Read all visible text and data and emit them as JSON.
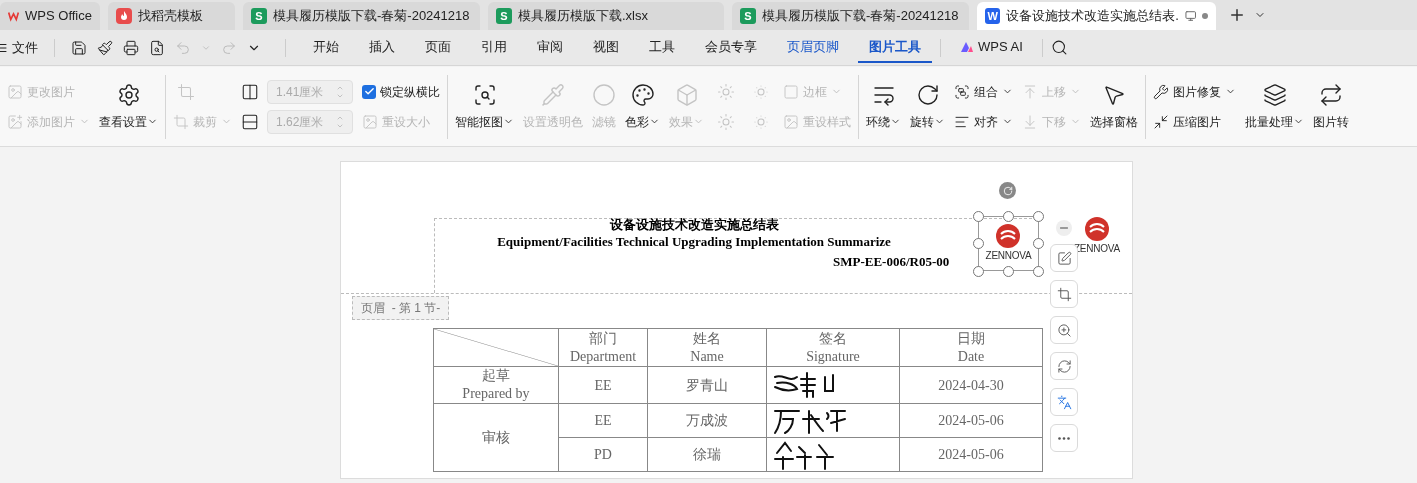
{
  "tabs": [
    {
      "label": "WPS Office",
      "kind": "wps",
      "selected": false
    },
    {
      "label": "找稻壳模板",
      "kind": "template",
      "selected": false
    },
    {
      "label": "模具履历模版下载-春菊-20241218",
      "kind": "sheet",
      "badge": "S",
      "selected": false
    },
    {
      "label": "模具履历模版下载.xlsx",
      "kind": "sheet",
      "badge": "S",
      "selected": false
    },
    {
      "label": "模具履历模版下载-春菊-20241218",
      "kind": "sheet",
      "badge": "S",
      "selected": false
    },
    {
      "label": "设备设施技术改造实施总结表.",
      "kind": "doc",
      "badge": "W",
      "selected": true
    }
  ],
  "menu": {
    "file": "文件",
    "items": [
      {
        "label": "开始",
        "kind": "plain",
        "selected": false
      },
      {
        "label": "插入",
        "kind": "plain",
        "selected": false
      },
      {
        "label": "页面",
        "kind": "plain",
        "selected": false
      },
      {
        "label": "引用",
        "kind": "plain",
        "selected": false
      },
      {
        "label": "审阅",
        "kind": "plain",
        "selected": false
      },
      {
        "label": "视图",
        "kind": "plain",
        "selected": false
      },
      {
        "label": "工具",
        "kind": "plain",
        "selected": false
      },
      {
        "label": "会员专享",
        "kind": "plain",
        "selected": false
      },
      {
        "label": "页眉页脚",
        "kind": "context",
        "selected": false
      },
      {
        "label": "图片工具",
        "kind": "context",
        "selected": true
      },
      {
        "label": "WPS AI",
        "kind": "ai",
        "selected": false
      }
    ]
  },
  "ribbon": {
    "groups": [
      {
        "columns": [
          {
            "kind": "stack",
            "items": [
              {
                "kind": "button",
                "label": "更改图片",
                "disabled": true,
                "dropdown": false
              },
              {
                "kind": "button",
                "label": "添加图片",
                "disabled": true,
                "dropdown": true
              }
            ]
          },
          {
            "kind": "large",
            "label": "查看设置",
            "disabled": false,
            "dropdown": true
          }
        ]
      },
      {
        "columns": [
          {
            "kind": "stack",
            "items": [
              {
                "kind": "icon",
                "disabled": true
              },
              {
                "kind": "button",
                "label": "裁剪",
                "disabled": true,
                "dropdown": true
              }
            ]
          },
          {
            "kind": "stack",
            "items": [
              {
                "kind": "size",
                "value": "1.41厘米",
                "disabled": true
              },
              {
                "kind": "size",
                "value": "1.62厘米",
                "disabled": true
              }
            ]
          },
          {
            "kind": "stack",
            "items": [
              {
                "kind": "check",
                "label": "锁定纵横比",
                "checked": true
              },
              {
                "kind": "button",
                "label": "重设大小",
                "disabled": true,
                "dropdown": false
              }
            ]
          }
        ]
      },
      {
        "columns": [
          {
            "kind": "large",
            "label": "智能抠图",
            "disabled": false,
            "dropdown": true
          },
          {
            "kind": "large",
            "label": "设置透明色",
            "disabled": true,
            "dropdown": false
          },
          {
            "kind": "large",
            "label": "滤镜",
            "disabled": true,
            "dropdown": false
          },
          {
            "kind": "large",
            "label": "色彩",
            "disabled": false,
            "dropdown": true
          },
          {
            "kind": "large",
            "label": "效果",
            "disabled": true,
            "dropdown": true
          },
          {
            "kind": "stack",
            "items": [
              {
                "kind": "icon",
                "disabled": true
              },
              {
                "kind": "icon",
                "disabled": true
              }
            ]
          },
          {
            "kind": "stack",
            "items": [
              {
                "kind": "icon",
                "disabled": true
              },
              {
                "kind": "icon",
                "disabled": true
              }
            ]
          },
          {
            "kind": "stack",
            "items": [
              {
                "kind": "button",
                "label": "边框",
                "disabled": true,
                "dropdown": true
              },
              {
                "kind": "button",
                "label": "重设样式",
                "disabled": true,
                "dropdown": false
              }
            ]
          }
        ]
      },
      {
        "columns": [
          {
            "kind": "large",
            "label": "环绕",
            "disabled": false,
            "dropdown": true
          },
          {
            "kind": "large",
            "label": "旋转",
            "disabled": false,
            "dropdown": true
          },
          {
            "kind": "stack",
            "items": [
              {
                "kind": "button",
                "label": "组合",
                "disabled": false,
                "dropdown": true
              },
              {
                "kind": "button",
                "label": "对齐",
                "disabled": false,
                "dropdown": true
              }
            ]
          },
          {
            "kind": "stack",
            "items": [
              {
                "kind": "button",
                "label": "上移",
                "disabled": true,
                "dropdown": true
              },
              {
                "kind": "button",
                "label": "下移",
                "disabled": true,
                "dropdown": true
              }
            ]
          },
          {
            "kind": "large",
            "label": "选择窗格",
            "disabled": false,
            "dropdown": false
          }
        ]
      },
      {
        "columns": [
          {
            "kind": "stack",
            "items": [
              {
                "kind": "button",
                "label": "图片修复",
                "disabled": false,
                "dropdown": true
              },
              {
                "kind": "button",
                "label": "压缩图片",
                "disabled": false,
                "dropdown": false
              }
            ]
          },
          {
            "kind": "large",
            "label": "批量处理",
            "disabled": false,
            "dropdown": true
          },
          {
            "kind": "large",
            "label": "图片转",
            "disabled": false,
            "dropdown": false
          }
        ]
      }
    ]
  },
  "document": {
    "header": {
      "title_zh": "设备设施技术改造实施总结表",
      "title_en": "Equipment/Facilities Technical Upgrading Implementation Summarize",
      "code": "SMP-EE-006/R05-00",
      "logos": [
        "ZENNOVA",
        "ZENNOVA"
      ],
      "section_label": "页眉  - 第 1 节-"
    },
    "table": {
      "columns": [
        {
          "zh": "部门",
          "en": "Department"
        },
        {
          "zh": "姓名",
          "en": "Name"
        },
        {
          "zh": "签名",
          "en": "Signature"
        },
        {
          "zh": "日期",
          "en": "Date"
        }
      ],
      "groups": [
        {
          "role_zh": "起草",
          "role_en": "Prepared by",
          "rows": [
            {
              "department": "EE",
              "name": "罗青山",
              "date": "2024-04-30"
            }
          ]
        },
        {
          "role_zh": "审核",
          "rows": [
            {
              "department": "EE",
              "name": "万成波",
              "date": "2024-05-06"
            },
            {
              "department": "PD",
              "name": "徐瑞",
              "date": "2024-05-06"
            }
          ]
        }
      ]
    }
  }
}
